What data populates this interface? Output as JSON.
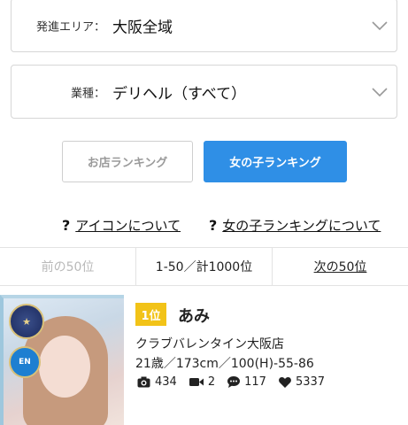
{
  "filters": {
    "area": {
      "label": "発進エリア：",
      "value": "大阪全域"
    },
    "genre": {
      "label": "業種：",
      "value": "デリヘル（すべて）"
    }
  },
  "ranking_tabs": {
    "shop": "お店ランキング",
    "girl": "女の子ランキング",
    "active": "girl"
  },
  "help_links": [
    {
      "icon": "question-icon",
      "label": "アイコンについて"
    },
    {
      "icon": "question-icon",
      "label": "女の子ランキングについて"
    }
  ],
  "pager": {
    "prev": "前の50位",
    "range": "1-50／計1000位",
    "next": "次の50位"
  },
  "entries": [
    {
      "rank": "1位",
      "name": "あみ",
      "shop": "クラブバレンタイン大阪店",
      "profile": "21歳／173cm／100(H)-55-86",
      "stats": {
        "photos": "434",
        "videos": "2",
        "comments": "117",
        "likes": "5337"
      }
    }
  ],
  "colors": {
    "accent": "#2f8fe6",
    "rank_badge": "#f2c318"
  }
}
